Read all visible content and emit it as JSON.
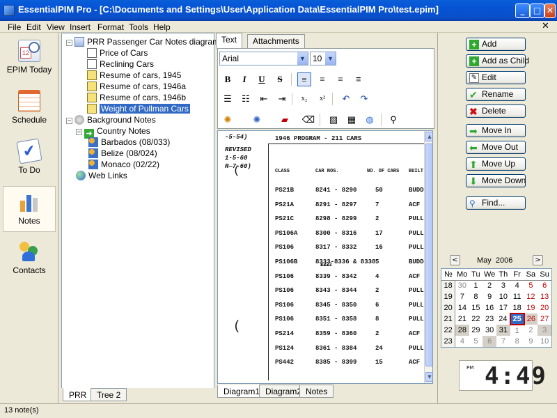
{
  "window": {
    "title": "EssentialPIM Pro - [C:\\Documents and Settings\\User\\Application Data\\EssentialPIM Pro\\test.epim]",
    "min_glyph": "_",
    "max_glyph": "□",
    "close_glyph": "✕"
  },
  "menu": {
    "items": [
      "File",
      "Edit",
      "View",
      "Insert",
      "Format",
      "Tools",
      "Help"
    ],
    "close_glyph": "✕"
  },
  "nav": {
    "items": [
      {
        "label": "EPIM Today",
        "icon": "clock-calendar-icon"
      },
      {
        "label": "Schedule",
        "icon": "calendar-icon"
      },
      {
        "label": "To Do",
        "icon": "checklist-icon"
      },
      {
        "label": "Notes",
        "icon": "notes-chart-icon"
      },
      {
        "label": "Contacts",
        "icon": "people-icon"
      }
    ],
    "selected": "Notes"
  },
  "tree": {
    "root": "PRR Passenger Car Notes diagrams",
    "children": [
      "Price of Cars",
      "Reclining Cars",
      "Resume of cars, 1945",
      "Resume of cars, 1946a",
      "Resume of cars, 1946b",
      "Weight of Pullman Cars"
    ],
    "selected": "Weight of Pullman Cars",
    "background": "Background Notes",
    "country": "Country Notes",
    "countries": [
      "Barbados (08/033)",
      "Belize (08/024)",
      "Monaco (02/22)"
    ],
    "web": "Web Links",
    "expander_minus": "−"
  },
  "tree_tabs": [
    "PRR",
    "Tree 2"
  ],
  "editor": {
    "tabs": [
      "Text",
      "Attachments"
    ],
    "font": "Arial",
    "size": "10",
    "format_buttons": [
      "B",
      "I",
      "U",
      "S"
    ],
    "bottom_tabs": [
      "Diagram1",
      "Diagram2",
      "Notes"
    ],
    "scan": {
      "margin_notes": [
        "-5-54)",
        "REVISED",
        "1-5-60",
        "R—7-60)"
      ],
      "title": "1946 PROGRAM  -  211 CARS",
      "headers": [
        "CLASS",
        "CAR NOS.",
        "NO. OF CARS",
        "BUILT"
      ],
      "rows": [
        [
          "PS21B",
          "8241 - 8290",
          "50",
          "BUDD"
        ],
        [
          "PS21A",
          "8291 - 8297",
          "7",
          "ACF"
        ],
        [
          "PS21C",
          "8298 - 8299",
          "2",
          "PULL"
        ],
        [
          "PS106A",
          "8300 - 8316",
          "17",
          "PULL"
        ],
        [
          "PS106",
          "8317 - 8332",
          "16",
          "PULL"
        ],
        [
          "PS106B",
          "8333-8336 & 8338",
          "5",
          "BUDD"
        ],
        [
          "PS106",
          "8339 - 8342",
          "4",
          "ACF"
        ],
        [
          "PS106",
          "8343 - 8344",
          "2",
          "PULL"
        ],
        [
          "PS106",
          "8345 - 8350",
          "6",
          "PULL"
        ],
        [
          "PS106",
          "8351 - 8358",
          "8",
          "PULL"
        ],
        [
          "PS214",
          "8359 - 8360",
          "2",
          "ACF"
        ],
        [
          "PS124",
          "8361 - 8384",
          "24",
          "PULL"
        ],
        [
          "PS442",
          "8385 - 8399",
          "15",
          "ACF"
        ]
      ],
      "strike_note": "8337",
      "paren": "("
    }
  },
  "actions": [
    "Add",
    "Add as Child",
    "Edit",
    "Rename",
    "Delete",
    "Move In",
    "Move Out",
    "Move Up",
    "Move Down",
    "Find..."
  ],
  "calendar": {
    "month": "May  2006",
    "prev": "<",
    "next": ">",
    "week_hdr": "№",
    "days": [
      "Mo",
      "Tu",
      "We",
      "Th",
      "Fr",
      "Sa",
      "Su"
    ],
    "weeks": [
      {
        "wk": "18",
        "d": [
          "30",
          "1",
          "2",
          "3",
          "4",
          "5",
          "6"
        ]
      },
      {
        "wk": "19",
        "d": [
          "7",
          "8",
          "9",
          "10",
          "11",
          "12",
          "13"
        ]
      },
      {
        "wk": "20",
        "d": [
          "14",
          "15",
          "16",
          "17",
          "18",
          "19",
          "20"
        ]
      },
      {
        "wk": "21",
        "d": [
          "21",
          "22",
          "23",
          "24",
          "25",
          "26",
          "27"
        ]
      },
      {
        "wk": "22",
        "d": [
          "28",
          "29",
          "30",
          "31",
          "1",
          "2",
          "3"
        ]
      },
      {
        "wk": "23",
        "d": [
          "4",
          "5",
          "6",
          "7",
          "8",
          "9",
          "10"
        ]
      }
    ],
    "today": "25"
  },
  "clock": {
    "ampm": "PM",
    "time": "4:49"
  },
  "status": "13 note(s)",
  "colors": {
    "title_blue": "#0553d4",
    "select": "#316ac5",
    "weekend": "#c00000"
  }
}
